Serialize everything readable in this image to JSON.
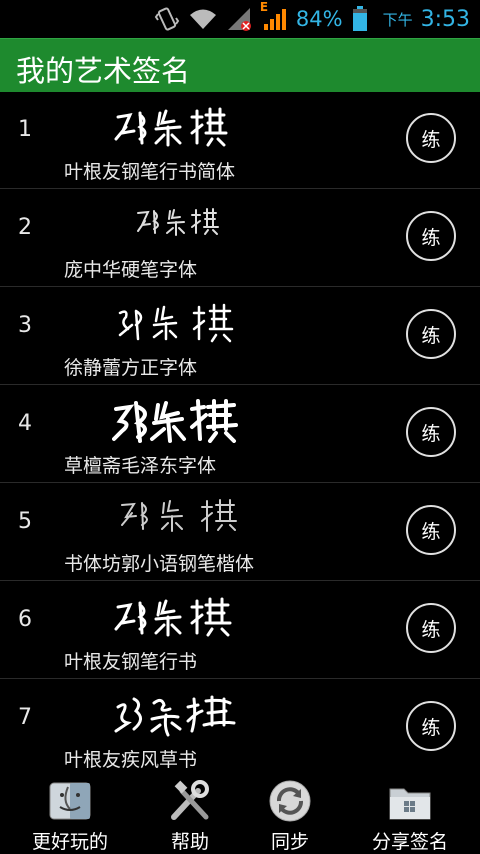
{
  "status_bar": {
    "battery_percent": "84%",
    "time_prefix": "下午",
    "time": "3:53",
    "network_label": "E",
    "colors": {
      "accent": "#33b5e5",
      "signal": "#ff8800"
    },
    "icons": [
      "vibrate-icon",
      "wifi-icon",
      "no-sim-signal-icon",
      "signal-icon",
      "battery-icon"
    ]
  },
  "header": {
    "title": "我的艺术签名",
    "color": "#1e8a2e"
  },
  "signature_name": "邓紫棋",
  "list": {
    "rows": [
      {
        "index": "1",
        "font": "叶根友钢笔行书简体",
        "practice": "练"
      },
      {
        "index": "2",
        "font": "庞中华硬笔字体",
        "practice": "练"
      },
      {
        "index": "3",
        "font": "徐静蕾方正字体",
        "practice": "练"
      },
      {
        "index": "4",
        "font": "草檀斋毛泽东字体",
        "practice": "练"
      },
      {
        "index": "5",
        "font": "书体坊郭小语钢笔楷体",
        "practice": "练"
      },
      {
        "index": "6",
        "font": "叶根友钢笔行书",
        "practice": "练"
      },
      {
        "index": "7",
        "font": "叶根友疾风草书",
        "practice": "练"
      }
    ]
  },
  "bottom_nav": {
    "tabs": [
      {
        "label": "更好玩的",
        "icon": "mac-finder-icon"
      },
      {
        "label": "帮助",
        "icon": "tools-icon"
      },
      {
        "label": "同步",
        "icon": "sync-icon"
      },
      {
        "label": "分享签名",
        "icon": "folder-windows-icon"
      }
    ]
  }
}
